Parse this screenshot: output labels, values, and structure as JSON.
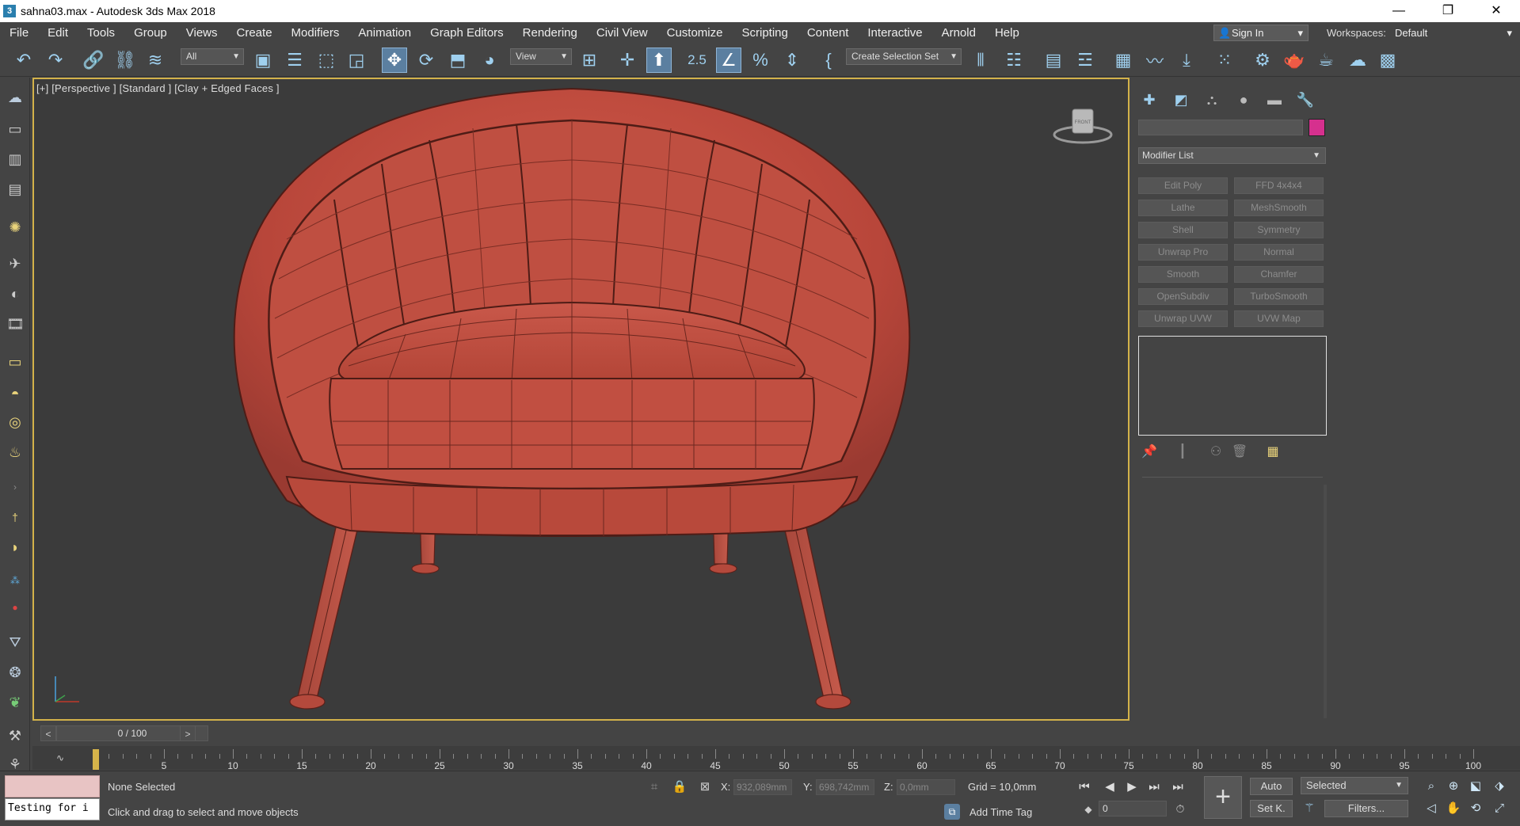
{
  "window": {
    "title": "sahna03.max - Autodesk 3ds Max 2018",
    "app_icon": "3",
    "controls": {
      "minimize": "—",
      "maximize": "❐",
      "close": "✕"
    }
  },
  "menu": [
    "File",
    "Edit",
    "Tools",
    "Group",
    "Views",
    "Create",
    "Modifiers",
    "Animation",
    "Graph Editors",
    "Rendering",
    "Civil View",
    "Customize",
    "Scripting",
    "Content",
    "Interactive",
    "Arnold",
    "Help"
  ],
  "account": {
    "sign_in": "Sign In",
    "workspaces_label": "Workspaces:",
    "workspace": "Default"
  },
  "toolbar": {
    "selection_filter": "All",
    "ref_coord": "View",
    "named_selection": "Create Selection Set",
    "snap_value": "2.5",
    "percent": "%"
  },
  "viewport": {
    "label": "[+] [Perspective ] [Standard ] [Clay + Edged Faces ]",
    "viewcube_face": "FRONT",
    "axes": {
      "x": "x",
      "y": "y",
      "z": "z"
    }
  },
  "command_panel": {
    "modifier_list": "Modifier List",
    "object_color": "#d6308e",
    "modifier_buttons": [
      [
        "Edit Poly",
        "FFD 4x4x4"
      ],
      [
        "Lathe",
        "MeshSmooth"
      ],
      [
        "Shell",
        "Symmetry"
      ],
      [
        "Unwrap Pro",
        "Normal"
      ],
      [
        "Smooth",
        "Chamfer"
      ],
      [
        "OpenSubdiv",
        "TurboSmooth"
      ],
      [
        "Unwrap UVW",
        "UVW Map"
      ]
    ]
  },
  "timeline": {
    "slider": "0 / 100",
    "prev": "<",
    "next": ">",
    "ticks": [
      "0",
      "5",
      "10",
      "15",
      "20",
      "25",
      "30",
      "35",
      "40",
      "45",
      "50",
      "55",
      "60",
      "65",
      "70",
      "75",
      "80",
      "85",
      "90",
      "95",
      "100"
    ]
  },
  "status": {
    "selection": "None Selected",
    "prompt": "Click and drag to select and move objects",
    "listener_text": "Testing for i",
    "x_label": "X:",
    "x_value": "932,089mm",
    "y_label": "Y:",
    "y_value": "698,742mm",
    "z_label": "Z:",
    "z_value": "0,0mm",
    "grid": "Grid = 10,0mm",
    "add_time_tag": "Add Time Tag",
    "frame": "0",
    "auto": "Auto",
    "set_key": "Set K.",
    "key_filter": "Selected",
    "filters": "Filters..."
  }
}
